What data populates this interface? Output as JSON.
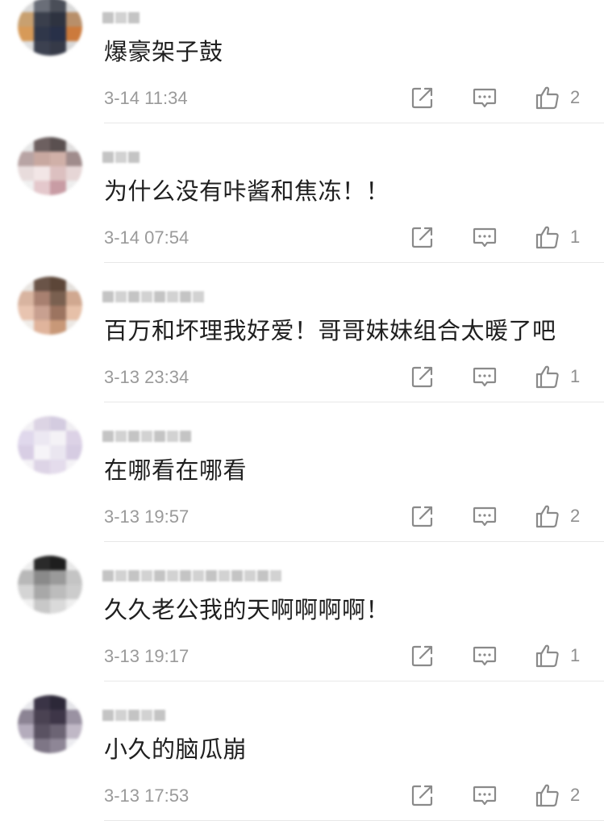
{
  "comments": [
    {
      "text": "爆豪架子鼓",
      "time": "3-14 11:34",
      "likes": "2",
      "avatar_colors": [
        "#d9d9d9",
        "#6a6e78",
        "#4a4e58",
        "#d8d8d8",
        "#c8a070",
        "#3a3f4c",
        "#2e3340",
        "#b88f6a",
        "#d79a58",
        "#30374a",
        "#283048",
        "#cc7a3c",
        "#e0e0e0",
        "#3c4150",
        "#363a48",
        "#d8d8d8"
      ],
      "name_blocks": 3
    },
    {
      "text": "为什么没有咔酱和焦冻！！",
      "time": "3-14 07:54",
      "likes": "1",
      "avatar_colors": [
        "#e6e6e6",
        "#6d6060",
        "#5a5050",
        "#e0dede",
        "#b8a4a4",
        "#c8a8a0",
        "#d0b0a8",
        "#a08c8c",
        "#e8dcdc",
        "#f2e6e6",
        "#dcc0c0",
        "#e6d6d6",
        "#f0f0f0",
        "#e4c8cc",
        "#c89ca4",
        "#eeeeee"
      ],
      "name_blocks": 3
    },
    {
      "text": "百万和坏理我好爱！哥哥妹妹组合太暖了吧",
      "time": "3-13 23:34",
      "likes": "1",
      "avatar_colors": [
        "#e8e4e0",
        "#6a5448",
        "#5c4638",
        "#e4e0dc",
        "#d8b4a0",
        "#a88070",
        "#7a6050",
        "#d0a890",
        "#e8c4b0",
        "#c8a090",
        "#9c7460",
        "#e6c0a8",
        "#f0ece8",
        "#e0b49c",
        "#c89878",
        "#ece8e4"
      ],
      "name_blocks": 8
    },
    {
      "text": "在哪看在哪看",
      "time": "3-13 19:57",
      "likes": "2",
      "avatar_colors": [
        "#f2f0f4",
        "#dcd4e4",
        "#d4cce0",
        "#f0eef2",
        "#e0d8ec",
        "#ece8f2",
        "#f4f2f6",
        "#dcd2e6",
        "#d8cee4",
        "#f6f4f8",
        "#eae6f0",
        "#d6cce2",
        "#f4f2f6",
        "#ddd4e6",
        "#e4dcec",
        "#f4f2f6"
      ],
      "name_blocks": 7
    },
    {
      "text": "久久老公我的天啊啊啊啊！",
      "time": "3-13 19:17",
      "likes": "1",
      "avatar_colors": [
        "#eeeeee",
        "#2a2a2a",
        "#1e1e1e",
        "#e8e8e8",
        "#b8b8b8",
        "#8a8a8a",
        "#9a9a9a",
        "#c4c4c4",
        "#d4d4d4",
        "#a8a8a8",
        "#bcbcbc",
        "#cccccc",
        "#f0f0f0",
        "#c8c8c8",
        "#dadada",
        "#eeeeee"
      ],
      "name_blocks": 14
    },
    {
      "text": "小久的脑瓜崩",
      "time": "3-13 17:53",
      "likes": "2",
      "avatar_colors": [
        "#e8e8ec",
        "#3a3446",
        "#2c2838",
        "#e4e4e8",
        "#8c8494",
        "#4a4252",
        "#3e3648",
        "#9a92a2",
        "#b4acbc",
        "#5a5262",
        "#6c6474",
        "#c0b8c6",
        "#ececf0",
        "#7e7686",
        "#8e8696",
        "#ececf0"
      ],
      "name_blocks": 5
    }
  ],
  "icons": {
    "share": "share-icon",
    "reply": "comment-icon",
    "like": "thumbs-up-icon"
  },
  "colors": {
    "text": "#1f1f1f",
    "meta": "#9a9a9a",
    "icon": "#8a8a8a",
    "divider": "#e8e8e8"
  }
}
